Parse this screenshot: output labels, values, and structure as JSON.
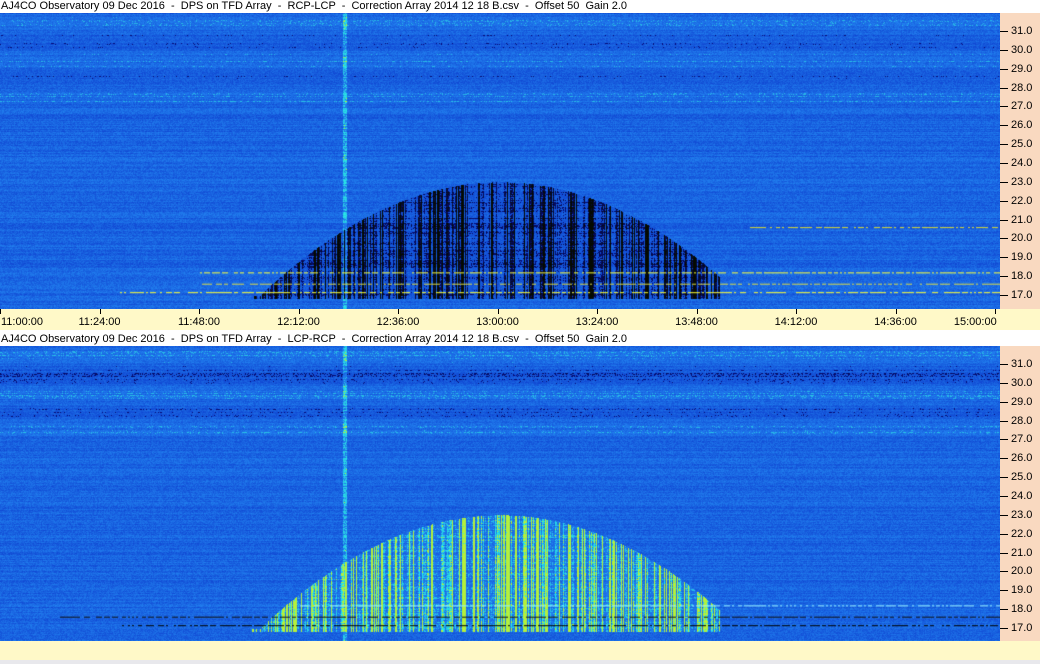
{
  "panels": [
    {
      "title": "AJ4CO Observatory 09 Dec 2016  -  DPS on TFD Array  -  RCP-LCP  -  Correction Array 2014 12 18 B.csv  -  Offset 50  Gain 2.0",
      "mode": "RCP-LCP"
    },
    {
      "title": "AJ4CO Observatory 09 Dec 2016  -  DPS on TFD Array  -  LCP-RCP  -  Correction Array 2014 12 18 B.csv  -  Offset 50  Gain 2.0",
      "mode": "LCP-RCP"
    }
  ],
  "chart_data": {
    "type": "heatmap",
    "x_ticks": [
      "11:00:00",
      "11:24:00",
      "11:48:00",
      "12:12:00",
      "12:36:00",
      "13:00:00",
      "13:24:00",
      "13:48:00",
      "14:12:00",
      "14:36:00",
      "15:00:00"
    ],
    "x_range_minutes": [
      0,
      240
    ],
    "y_ticks": [
      "17.0",
      "18.0",
      "19.0",
      "20.0",
      "21.0",
      "22.0",
      "23.0",
      "24.0",
      "25.0",
      "26.0",
      "27.0",
      "28.0",
      "29.0",
      "30.0",
      "31.0"
    ],
    "y_range_mhz": [
      16.6,
      32.0
    ],
    "features": {
      "burst_center_time": "13:00:00",
      "burst_start": "12:12:00",
      "burst_end": "13:50:00",
      "burst_top_mhz": 23.0,
      "burst_bottom_mhz": 17.0
    },
    "colors": {
      "background": "#1e5ad8",
      "rcp_burst": "#0a1450",
      "lcp_burst": "#b8f040"
    }
  }
}
